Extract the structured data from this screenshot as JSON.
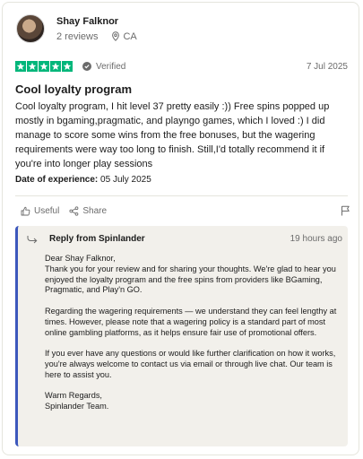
{
  "reviewer": {
    "name": "Shay Falknor",
    "reviews": "2 reviews",
    "country": "CA"
  },
  "rating": {
    "stars": 5,
    "verified_label": "Verified",
    "date": "7 Jul 2025"
  },
  "review": {
    "title": "Cool loyalty program",
    "body": "Cool loyalty program, I hit level 37 pretty easily :)) Free spins popped up mostly in bgaming,pragmatic, and playngo games, which I loved :) I did manage to score some wins from the free bonuses, but the wagering requirements were way too long to finish. Still,I'd totally recommend it if you're into longer play sessions",
    "experience_label": "Date of experience:",
    "experience_date": "05 July 2025"
  },
  "actions": {
    "useful": "Useful",
    "share": "Share"
  },
  "reply": {
    "title": "Reply from Spinlander",
    "time": "19 hours ago",
    "greeting": "Dear Shay Falknor,",
    "p1": "Thank you for your review and for sharing your thoughts. We're glad to hear you enjoyed the loyalty program and the free spins from providers like BGaming, Pragmatic, and Play'n GO.",
    "p2": "Regarding the wagering requirements — we understand they can feel lengthy at times. However, please note that a wagering policy is a standard part of most online gambling platforms, as it helps ensure fair use of promotional offers.",
    "p3": "If you ever have any questions or would like further clarification on how it works, you're always welcome to contact us via email or through live chat. Our team is here to assist you.",
    "signoff": "Warm Regards,",
    "signature": "Spinlander Team."
  },
  "colors": {
    "star_green": "#00b67a",
    "reply_accent": "#3c57bc",
    "reply_bg": "#f2f0eb"
  }
}
